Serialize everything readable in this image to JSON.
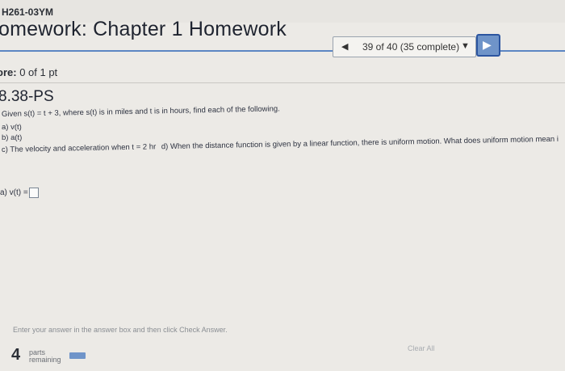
{
  "header": {
    "course_code": "H261-03YM",
    "title": "omework: Chapter 1 Homework"
  },
  "nav": {
    "prev_icon": "◀",
    "progress": "39 of 40 (35 complete)",
    "dropdown_icon": "▼",
    "next_icon": "▶"
  },
  "score": {
    "label": "ore:",
    "value": "0 of 1 pt"
  },
  "question": {
    "id": "8.38-PS",
    "intro": "Given s(t) = t + 3, where s(t) is in miles and t is in hours, find each of the following.",
    "parts": [
      "a) v(t)",
      "b) a(t)",
      "c) The velocity and acceleration when t = 2 hr",
      "d) When the distance function is given by a linear function, there is uniform motion. What does uniform motion mean in terms of velocity and acceleration?"
    ]
  },
  "answer": {
    "label": "a) v(t) ="
  },
  "footer": {
    "instruction": "Enter your answer in the answer box and then click Check Answer.",
    "parts_count": "4",
    "parts_label_1": "parts",
    "parts_label_2": "remaining",
    "parts_progress_fraction": 0.25,
    "clear_all": "Clear All"
  },
  "colors": {
    "accent": "#6f94c9",
    "rule": "#5c86c3"
  }
}
